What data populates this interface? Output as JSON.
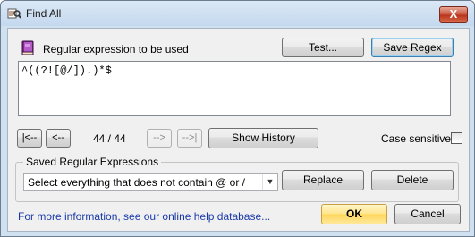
{
  "window": {
    "title": "Find All",
    "close_glyph": "X"
  },
  "regex": {
    "label": "Regular expression to be used",
    "value": "^((?![@/]).)*$",
    "test_label": "Test...",
    "save_label": "Save Regex"
  },
  "history": {
    "first_label": "|<--",
    "prev_label": "<--",
    "position": "44 / 44",
    "next_label": "-->",
    "last_label": "-->|",
    "show_label": "Show History"
  },
  "case_sensitive": {
    "label": "Case sensitive",
    "checked": false
  },
  "saved": {
    "group_label": "Saved Regular Expressions",
    "selected": "Select everything that does not contain @ or /",
    "replace_label": "Replace",
    "delete_label": "Delete"
  },
  "footer": {
    "help_link": "For more information, see our online help database...",
    "ok_label": "OK",
    "cancel_label": "Cancel"
  },
  "icons": {
    "title": "find-all-app-icon",
    "regex": "book-icon",
    "close": "close-icon",
    "dropdown": "chevron-down-icon"
  }
}
